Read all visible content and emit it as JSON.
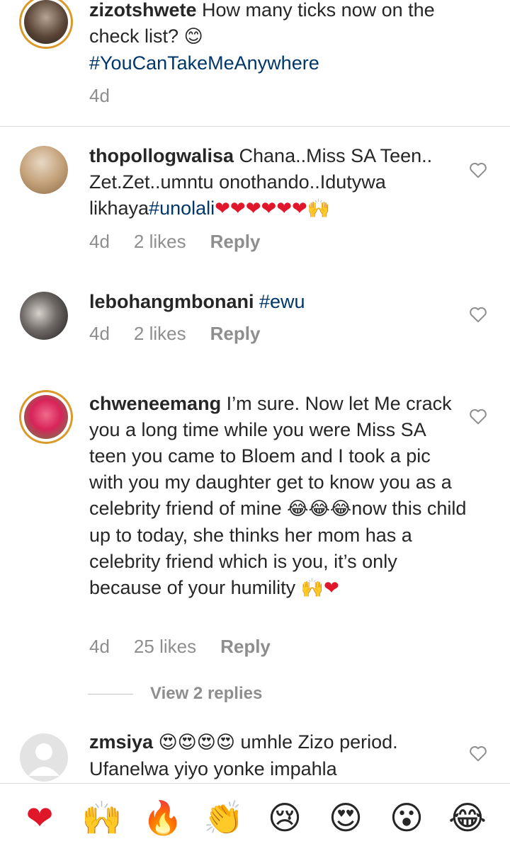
{
  "comments": [
    {
      "username": "zizotshwete",
      "text": "How many ticks now on the check list?",
      "emoji": "😊",
      "hashtag": "#YouCanTakeMeAnywhere",
      "time": "4d"
    },
    {
      "username": "thopollogwalisa",
      "text": "Chana..Miss SA Teen.. Zet.Zet..umntu onothando..Idutywa likhaya",
      "hashtag": "#unolali",
      "emoji": "❤❤❤❤❤❤🙌",
      "time": "4d",
      "likes": "2 likes",
      "reply": "Reply"
    },
    {
      "username": "lebohangmbonani",
      "hashtag": "#ewu",
      "time": "4d",
      "likes": "2 likes",
      "reply": "Reply"
    },
    {
      "username": "chweneemang",
      "text_part1": "I’m sure. Now let Me crack you a long time while you were Miss SA teen you came to Bloem and I took a pic with you my daughter get to know you as a celebrity friend of mine",
      "emoji_mid": "😂😂😂",
      "text_part2": "now this child up to today, she thinks her mom has a celebrity friend which is you, it’s only because of your humility",
      "emoji_end": "🙌❤",
      "time": "4d",
      "likes": "25 likes",
      "reply": "Reply",
      "view_replies": "View 2 replies"
    },
    {
      "username": "zmsiya",
      "emoji": "😍😍😍😍",
      "text": "umhle Zizo period. Ufanelwa yiyo yonke impahla"
    }
  ],
  "reactions": [
    {
      "icon": "red-heart-icon",
      "glyph": "❤"
    },
    {
      "icon": "raising-hands-icon",
      "glyph": "🙌"
    },
    {
      "icon": "fire-icon",
      "glyph": "🔥"
    },
    {
      "icon": "clapping-hands-icon",
      "glyph": "👏"
    },
    {
      "icon": "sad-face-icon",
      "glyph": "😢"
    },
    {
      "icon": "heart-eyes-icon",
      "glyph": "😍"
    },
    {
      "icon": "surprised-face-icon",
      "glyph": "😮"
    },
    {
      "icon": "tears-of-joy-icon",
      "glyph": "😂"
    }
  ],
  "colors": {
    "accent_link": "#00376b",
    "meta_grey": "#8e8e8e",
    "heart_red": "#e0172b"
  }
}
